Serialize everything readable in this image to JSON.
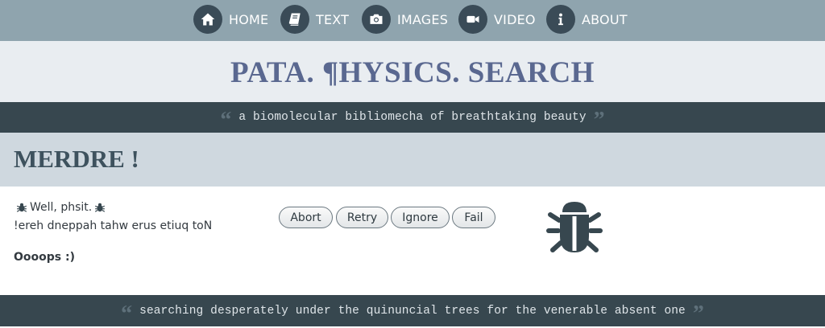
{
  "nav": {
    "items": [
      {
        "label": "HOME",
        "icon": "home-icon"
      },
      {
        "label": "TEXT",
        "icon": "book-icon"
      },
      {
        "label": "IMAGES",
        "icon": "camera-icon"
      },
      {
        "label": "VIDEO",
        "icon": "video-camera-icon"
      },
      {
        "label": "ABOUT",
        "icon": "info-icon"
      }
    ]
  },
  "header": {
    "title": "PATA. ¶HYSICS. SEARCH"
  },
  "tagline": {
    "text": "a biomolecular bibliomecha of breathtaking beauty"
  },
  "error": {
    "heading": "MERDRE !",
    "line1": "Well, phsit.",
    "line2": "!ereh dneppah tahw erus etiuq toN",
    "line3": "Oooops :)",
    "icon": "bug-icon"
  },
  "buttons": {
    "abort": "Abort",
    "retry": "Retry",
    "ignore": "Ignore",
    "fail": "Fail"
  },
  "footer_quote": {
    "text": "searching desperately under the quinuncial trees for the venerable absent one"
  },
  "colors": {
    "nav_bg": "#8fa4ae",
    "nav_icon_bg": "#3a4b57",
    "title_band_bg": "#e9edf1",
    "title_color": "#5a6890",
    "quote_bar_bg": "#37474f",
    "heading_band_bg": "#cfd8df",
    "heading_color": "#3e525e",
    "bug_color": "#37474f"
  }
}
